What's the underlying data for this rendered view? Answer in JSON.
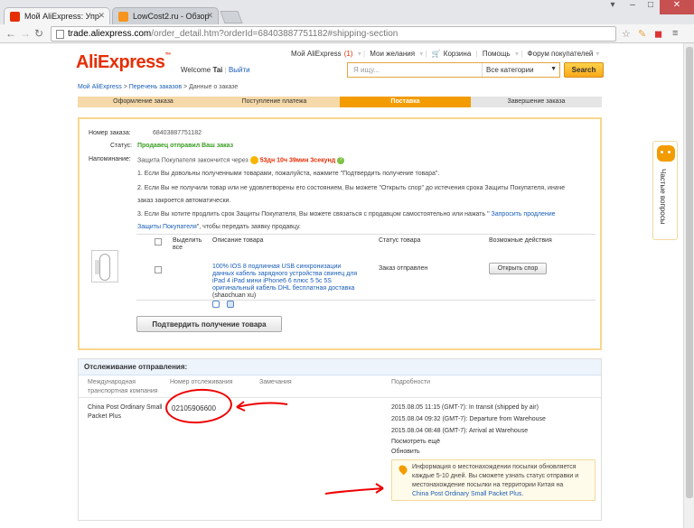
{
  "browser": {
    "tabs": [
      {
        "title": "Мой AliExpress: Упр",
        "active": true
      },
      {
        "title": "LowCost2.ru - Обзор",
        "active": false
      }
    ],
    "url_host": "trade.aliexpress.com",
    "url_path": "/order_detail.htm?orderId=68403887751182#shipping-section",
    "colors": {
      "chrome": "#e4e6e9",
      "accent": "#e62e04"
    }
  },
  "header": {
    "logo": "AliExpress",
    "welcome": "Welcome",
    "user": "Tai",
    "logout": "Выйти",
    "nav": [
      "Мой AliExpress",
      "(1)",
      "Мои желания",
      "Корзина",
      "Помощь",
      "Форум покупателей"
    ],
    "search_placeholder": "Я ищу...",
    "category": "Все категории",
    "search_button": "Search"
  },
  "breadcrumb": {
    "home": "Мой AliExpress",
    "sep1": ">",
    "list": "Перечень заказов",
    "sep2": ">",
    "current": "Данные о заказе"
  },
  "steps": [
    "Оформление заказа",
    "Поступление платежа",
    "Поставка",
    "Завершение заказа"
  ],
  "order": {
    "number_label": "Номер заказа:",
    "number": "68403887751182",
    "status_label": "Статус:",
    "status": "Продавец отправил Ваш заказ",
    "reminder_label": "Напоминание:",
    "reminder": "Защита Покупателя закончится через",
    "timer": "53дн 10ч 39мин 3секунд",
    "notes": [
      "1. Если Вы довольны полученными товарами, пожалуйста, нажмите \"Подтвердить получение товара\".",
      "2. Если Вы не получили товар или не удовлетворены его состоянием, Вы можете \"Открыть спор\" до истечения срока Защиты Покупателя, иначе",
      "заказ закроется автоматически.",
      "3. Если Вы хотите продлить срок Защиты Покупателя, Вы можете связаться с продавцом самостоятельно или нажать \"",
      "Запросить продление",
      "Защиты Покупателя",
      "\", чтобы передать заявку продавцу."
    ],
    "table": {
      "col_select": "Выделить",
      "col_select2": "все",
      "col_desc": "Описание товара",
      "col_status": "Статус товара",
      "col_actions": "Возможные действия",
      "product_title": [
        "100% IOS 8 подлинная USB синхронизации",
        "данных кабель зарядного устройства свинец для",
        "iPad 4 iPad мини iPhone6 6 плюс 5 5c 5S",
        "оригинальный кабель DHL бесплатная доставка"
      ],
      "seller": "(shaochuan xu)",
      "item_status": "Заказ отправлен",
      "dispute_button": "Открыть спор"
    },
    "confirm_button": "Подтвердить получение товара"
  },
  "tracking": {
    "title": "Отслеживание отправления:",
    "col_carrier": [
      "Международная",
      "транспортная компания"
    ],
    "col_number": "Номер отслеживания",
    "col_notes": "Замечания",
    "col_details": "Подробности",
    "carrier": [
      "China Post Ordinary Small",
      "Packet Plus"
    ],
    "tracking_number": "02105906600",
    "events": [
      "2015.08.05 11:15 (GMT-7): In transit (shipped by air)",
      "2015.08.04 09:32 (GMT-7): Departure from Warehouse",
      "2015.08.04 08:48 (GMT-7): Arrival at Warehouse"
    ],
    "show_all": "Посмотреть ещё",
    "refresh": "Обновить",
    "info": [
      "Информация о местонахождении посылки обновляется",
      "каждые 5-10 дней. Вы сможете узнать статус отправки и",
      "местонахождение посылки на территории Китая на"
    ],
    "info_link": "China Post Ordinary Small Packet Plus",
    "info_end": "."
  },
  "helper": {
    "label": "Частые вопросы"
  },
  "annotation_color": "#e00000"
}
